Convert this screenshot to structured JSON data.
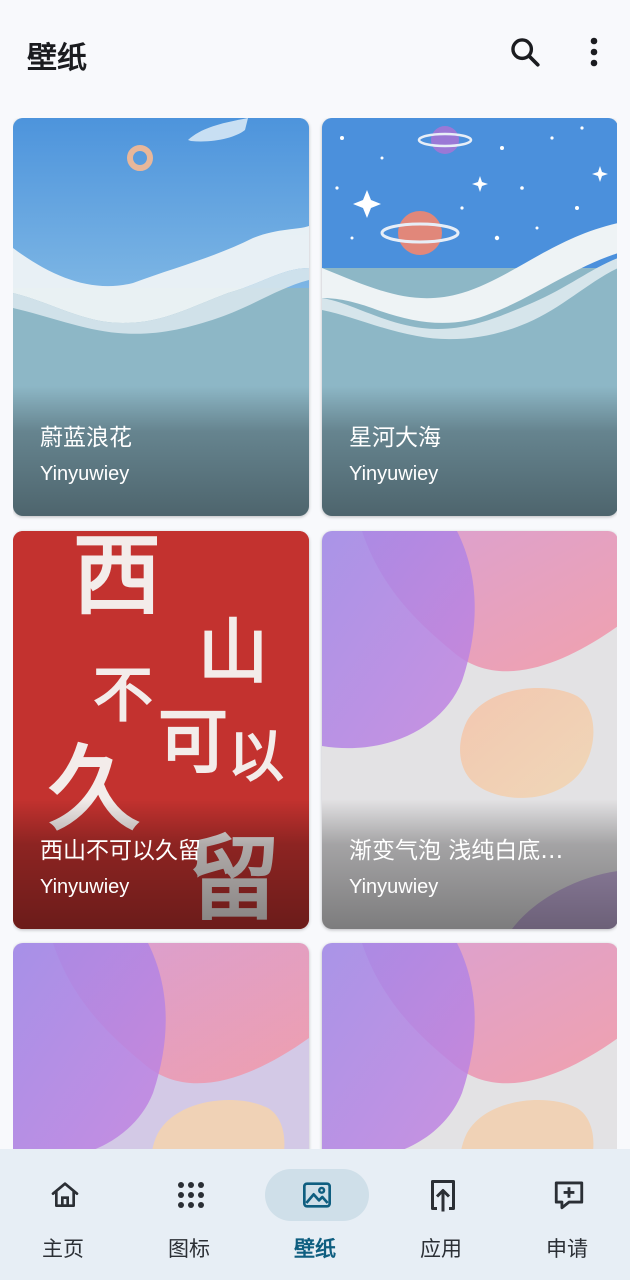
{
  "header": {
    "title": "壁纸"
  },
  "wallpapers": [
    {
      "title": "蔚蓝浪花",
      "author": "Yinyuwiey"
    },
    {
      "title": "星河大海",
      "author": "Yinyuwiey"
    },
    {
      "title": "西山不可以久留",
      "author": "Yinyuwiey",
      "art_text": [
        "西",
        "山",
        "不",
        "可",
        "以",
        "久",
        "留"
      ]
    },
    {
      "title": "渐变气泡 浅纯白底…",
      "author": "Yinyuwiey"
    },
    {
      "title": "",
      "author": ""
    },
    {
      "title": "",
      "author": ""
    }
  ],
  "nav": {
    "items": [
      {
        "label": "主页",
        "icon": "home-icon"
      },
      {
        "label": "图标",
        "icon": "grid-icon"
      },
      {
        "label": "壁纸",
        "icon": "image-icon"
      },
      {
        "label": "应用",
        "icon": "upload-icon"
      },
      {
        "label": "申请",
        "icon": "feedback-icon"
      }
    ],
    "active_index": 2
  },
  "colors": {
    "accent": "#0f5e80",
    "active_pill": "#cfdfe9",
    "nav_bg": "#e7eef5",
    "background": "#f8f9fc"
  }
}
